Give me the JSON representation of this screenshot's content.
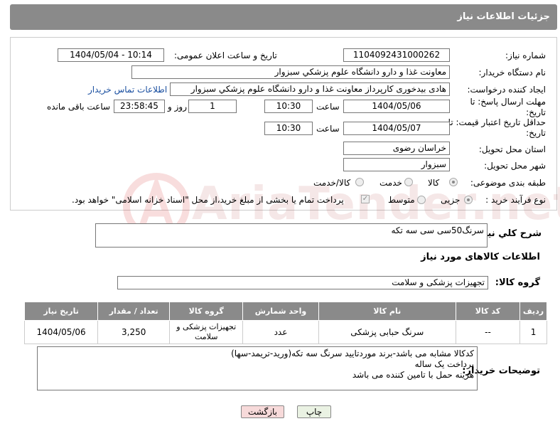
{
  "header": {
    "title": "جزئیات اطلاعات نیاز"
  },
  "fields": {
    "need_number_label": "شماره نیاز:",
    "need_number": "1104092431000262",
    "announce_label": "تاریخ و ساعت اعلان عمومی:",
    "announce_value": "1404/05/04 - 10:14",
    "buyer_org_label": "نام دستگاه خریدار:",
    "buyer_org": "معاونت غذا و دارو   دانشگاه علوم پزشکي سبزوار",
    "requester_label": "ایجاد کننده درخواست:",
    "requester": "هادی بیدخوری کارپرداز معاونت غذا و دارو   دانشگاه علوم پزشکي سبزوار",
    "contact_link": "اطلاعات تماس خریدار",
    "deadline_label": "مهلت ارسال پاسخ: تا تاریخ:",
    "deadline_date": "1404/05/06",
    "time_label": "ساعت",
    "deadline_time": "10:30",
    "days_value": "1",
    "days_label": "روز و",
    "remaining": "23:58:45",
    "remaining_label": "ساعت باقی مانده",
    "min_price_label": "حداقل تاریخ اعتبار قیمت: تا تاریخ:",
    "min_price_date": "1404/05/07",
    "min_price_time": "10:30",
    "province_label": "استان محل تحویل:",
    "province": "خراسان رضوی",
    "city_label": "شهر محل تحویل:",
    "city": "سبزوار",
    "category_label": "طبقه بندی موضوعی:",
    "cat_goods": "کالا",
    "cat_service": "خدمت",
    "cat_both": "کالا/خدمت",
    "process_label": "نوع فرآیند خرید :",
    "proc_partial": "جزیی",
    "proc_medium": "متوسط",
    "payment_note": "پرداخت تمام یا بخشی از مبلغ خرید،از محل \"اسناد خزانه اسلامی\" خواهد بود."
  },
  "description": {
    "label": "شرح کلي نیاز:",
    "value": "سرنگ50سی سی سه تکه"
  },
  "goods": {
    "section_title": "اطلاعات کالاهای مورد نیاز",
    "group_label": "گروه کالا:",
    "group_value": "تجهیزات پزشکی و سلامت",
    "columns": [
      "ردیف",
      "کد کالا",
      "نام کالا",
      "واحد شمارش",
      "گروه کالا",
      "تعداد / مقدار",
      "تاریخ نیاز"
    ],
    "rows": [
      [
        "1",
        "--",
        "سرنگ حبابی پزشکی",
        "عدد",
        "تجهیزات پزشکی و سلامت",
        "3,250",
        "1404/05/06"
      ]
    ]
  },
  "buyer_notes": {
    "label": "توضیحات خریدار:",
    "lines": [
      "کدکالا مشابه می باشد-برند موردتایید سرنگ سه تکه(ورید-تریمد-سها)",
      "پرداخت یک ساله",
      "هزینه حمل با تامین کننده می باشد"
    ]
  },
  "buttons": {
    "print": "چاپ",
    "back": "بازگشت"
  },
  "watermark": {
    "brand": "AriaTender.net"
  },
  "colors": {
    "header_bg": "#8a8a8a",
    "link": "#1a4fa0",
    "back_button_bg": "#f7dada"
  }
}
